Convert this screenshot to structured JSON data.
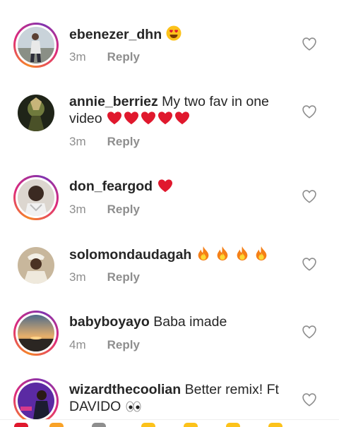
{
  "comments": [
    {
      "username": "ebenezer_dhn",
      "text": "",
      "time": "3m",
      "reply_label": "Reply"
    },
    {
      "username": "annie_berriez",
      "text": "My two fav in one video",
      "time": "3m",
      "reply_label": "Reply"
    },
    {
      "username": "don_feargod",
      "text": "",
      "time": "3m",
      "reply_label": "Reply"
    },
    {
      "username": "solomondaudagah",
      "text": "",
      "time": "3m",
      "reply_label": "Reply"
    },
    {
      "username": "babyboyayo",
      "text": "Baba imade",
      "time": "4m",
      "reply_label": "Reply"
    },
    {
      "username": "wizardthecoolian",
      "text": "Better remix! Ft DAVIDO",
      "time": "",
      "reply_label": ""
    }
  ],
  "icons": {
    "like": "heart-outline-icon",
    "heart_eyes": "heart-eyes-emoji",
    "red_heart": "red-heart-emoji",
    "fire": "fire-emoji",
    "eyes": "eyes-emoji"
  },
  "colors": {
    "text": "#262626",
    "secondary": "#8e8e8e",
    "story_ring": [
      "#f58529",
      "#dd2a7b",
      "#8134af"
    ],
    "heart": "#e0182d",
    "fire": "#f9a227"
  }
}
